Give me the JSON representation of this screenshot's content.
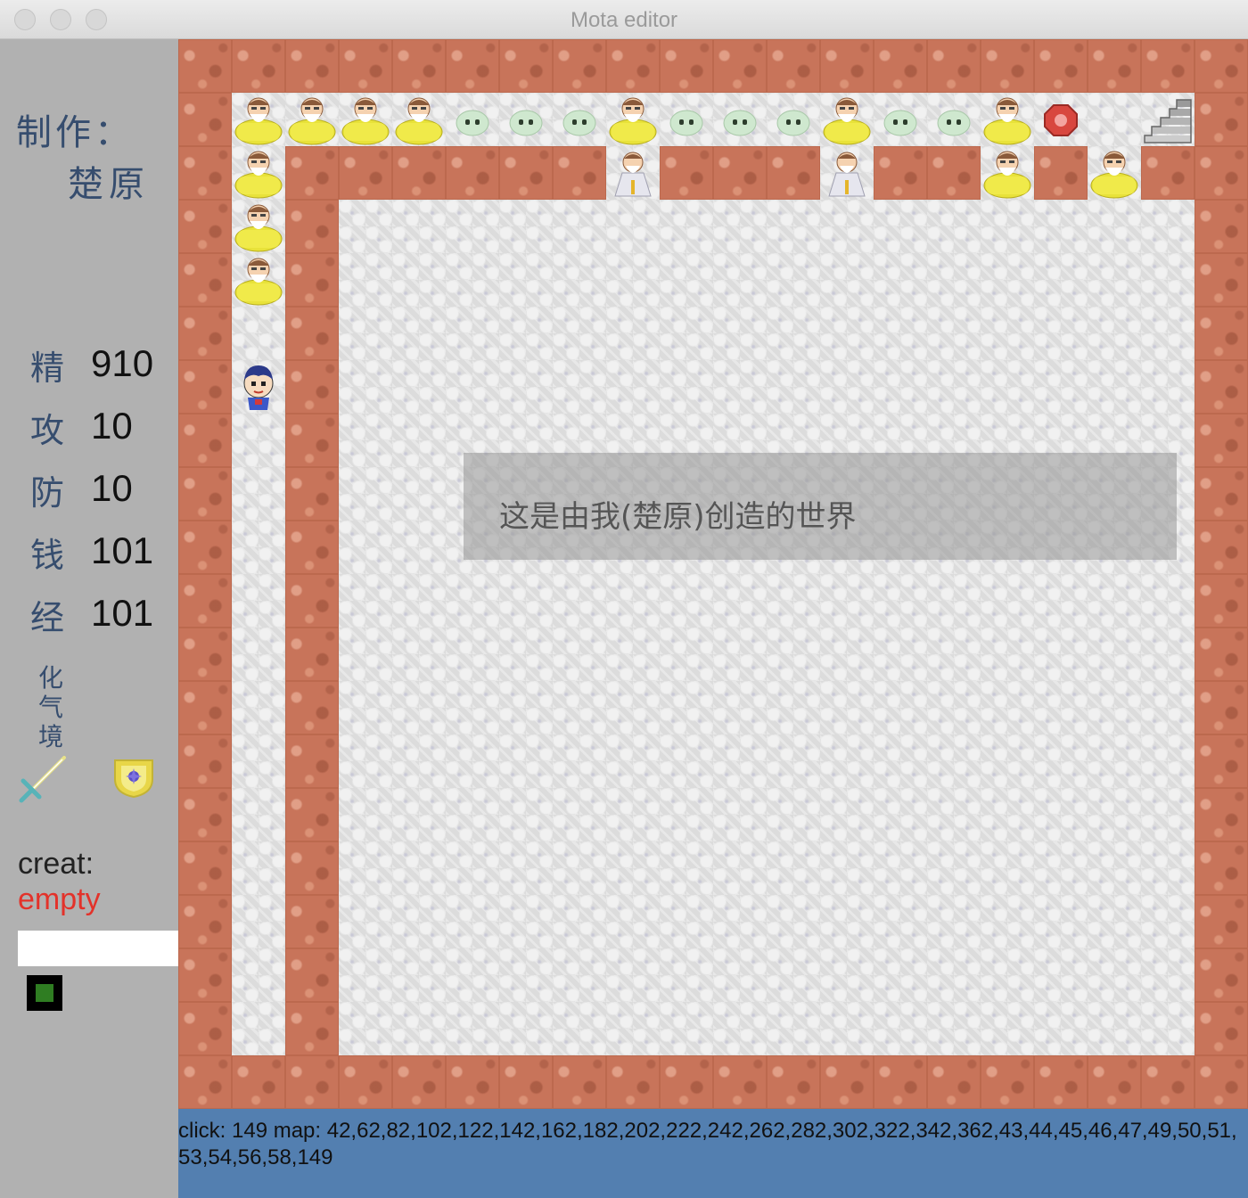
{
  "window": {
    "title": "Mota editor"
  },
  "sidebar": {
    "maker_label": "制作：",
    "maker_name": "楚原",
    "stats": [
      {
        "label": "精",
        "value": "910"
      },
      {
        "label": "攻",
        "value": "10"
      },
      {
        "label": "防",
        "value": "10"
      },
      {
        "label": "钱",
        "value": "101"
      },
      {
        "label": "经",
        "value": "101"
      }
    ],
    "realm": "化气境",
    "equipment": {
      "weapon": "sword-icon",
      "armor": "shield-icon"
    },
    "creat_label": "creat:",
    "creat_value": "empty",
    "creat_input_value": "",
    "swatch_color": "#2f7d22"
  },
  "map": {
    "grid_columns": 20,
    "grid_rows": 20,
    "wall_color": "#c8745a",
    "floor_color": "#dcdcdc",
    "dialog_text": "这是由我(楚原)创造的世界",
    "row1_tiles": [
      "sage",
      "sage",
      "sage",
      "sage",
      "slime",
      "slime",
      "slime",
      "sage",
      "slime",
      "slime",
      "slime",
      "sage",
      "slime",
      "slime",
      "sage",
      "gem",
      "floor",
      "stairs"
    ],
    "row2_tiles": [
      "sage",
      "wall",
      "wall",
      "wall",
      "wall",
      "wall",
      "wall",
      "priest",
      "wall",
      "wall",
      "wall",
      "priest",
      "wall",
      "wall",
      "sage",
      "wall",
      "sage",
      "wall"
    ],
    "player_icon": "hero-icon"
  },
  "status": {
    "text": "click: 149 map: 42,62,82,102,122,142,162,182,202,222,242,262,282,302,322,342,362,43,44,45,46,47,49,50,51,53,54,56,58,149"
  }
}
